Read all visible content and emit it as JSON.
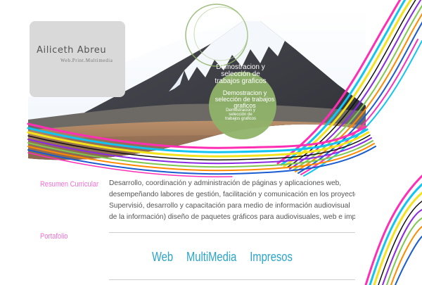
{
  "brand": {
    "name": "Ailiceth Abreu",
    "tagline": "Web.Print.Multimedia"
  },
  "badge": {
    "line1": "Demostracion y selección de trabajos graficos",
    "line2": "Demostracion y selección de trabajos graficos",
    "line3": "Demostracion y selección de trabajos graficos"
  },
  "sections": {
    "resumen_label": "Resumen Curricular",
    "portafolio_label": "Portafolio"
  },
  "resume": {
    "lines": [
      "Desarrollo, coordinación y administración de páginas y aplicaciones web,",
      "desempeñando labores de gestión, facilitación y comunicación en los proyectos",
      "Supervisió, desarrollo y capacitación para medio de información audiovisual",
      "de la información) diseño de paquetes gráficos para audiovisuales, web e impresos"
    ]
  },
  "nav": {
    "web": "Web",
    "multimedia": "MultiMedia",
    "impresos": "Impresos"
  },
  "colors": {
    "accent_pink": "#f06fd4",
    "accent_cyan": "#2aa5c9",
    "badge_green": "#8fb36a",
    "brand_box": "#d9d9d9",
    "stripe_palette": [
      "#ff2fb4",
      "#14c4f0",
      "#f4e21a",
      "#111111",
      "#8a2be2",
      "#7ec850",
      "#ff8a00",
      "#1a5ccf"
    ]
  }
}
